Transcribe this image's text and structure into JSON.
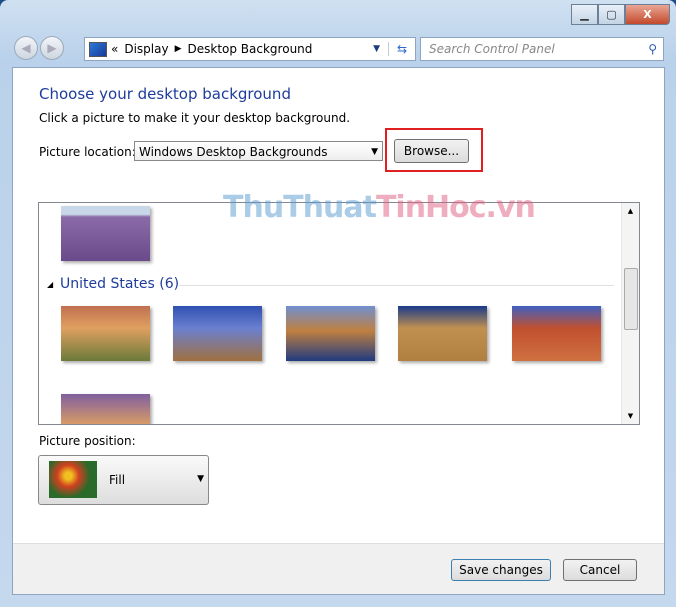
{
  "address": {
    "breadcrumb": [
      "Display",
      "Desktop Background"
    ]
  },
  "search": {
    "placeholder": "Search Control Panel"
  },
  "main": {
    "title": "Choose your desktop background",
    "subtitle": "Click a picture to make it your desktop background.",
    "picture_location_label": "Picture location:",
    "picture_location_value": "Windows Desktop Backgrounds",
    "browse_label": "Browse...",
    "group_label": "United States (6)",
    "picture_position_label": "Picture position:",
    "picture_position_value": "Fill"
  },
  "watermark": {
    "part1": "ThuThuat",
    "part2": "TinHoc.vn"
  },
  "footer": {
    "save_label": "Save changes",
    "cancel_label": "Cancel"
  }
}
